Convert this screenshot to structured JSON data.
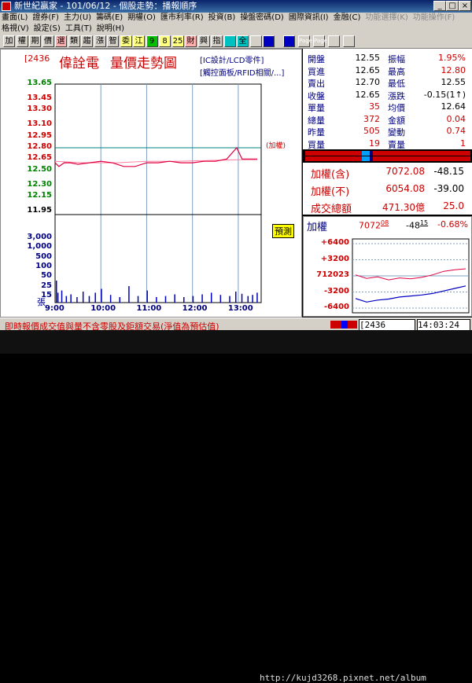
{
  "window": {
    "title": "新世紀贏家 - 101/06/12 - 個股走勢：播報順序"
  },
  "menu1": [
    "畫面(L)",
    "證券(F)",
    "主力(U)",
    "籌碼(E)",
    "期權(O)",
    "匯市利率(R)",
    "投資(B)",
    "操盤密碼(D)",
    "國際資訊(I)",
    "金融(C)",
    "功能選擇(K)",
    "功能操作(F)"
  ],
  "menu2": [
    "格視(V)",
    "設定(S)",
    "工具(T)",
    "說明(H)"
  ],
  "toolbar": [
    "加",
    "權",
    "期",
    "價",
    "選",
    "類",
    "趨",
    "漲",
    "智",
    "委",
    "江",
    "9",
    "8",
    "25",
    "財",
    "興",
    "指",
    "",
    "全",
    "",
    "",
    "",
    "Page",
    "Page",
    "",
    ""
  ],
  "stock": {
    "code": "[2436",
    "name": "偉詮電",
    "chart_title": "量價走勢圖",
    "industry1": "[IC設計/LCD零件]",
    "industry2": "[觸控面板/RFID相關/...]"
  },
  "lot_label": "(加權)",
  "vol_unit": "張",
  "estimate_tag": "預測",
  "chart_data": {
    "type": "line",
    "x_ticks": [
      "9:00",
      "10:00",
      "11:00",
      "12:00",
      "13:00"
    ],
    "price_ticks": [
      "13.65",
      "13.45",
      "13.30",
      "13.10",
      "12.95",
      "12.80",
      "12.65",
      "12.50",
      "12.30",
      "12.15",
      "11.95"
    ],
    "price_tick_colors": [
      "#008000",
      "#c00",
      "#c00",
      "#c00",
      "#c00",
      "#c00",
      "#c00",
      "#008000",
      "#008000",
      "#008000",
      "#000"
    ],
    "vol_ticks": [
      "3,000",
      "1,000",
      "500",
      "100",
      "50",
      "25",
      "15"
    ],
    "ref_price": 12.8,
    "ylim": [
      11.95,
      13.65
    ],
    "price_series": [
      {
        "t": 0,
        "v": 12.6
      },
      {
        "t": 5,
        "v": 12.55
      },
      {
        "t": 12,
        "v": 12.6
      },
      {
        "t": 20,
        "v": 12.6
      },
      {
        "t": 30,
        "v": 12.58
      },
      {
        "t": 45,
        "v": 12.6
      },
      {
        "t": 60,
        "v": 12.62
      },
      {
        "t": 75,
        "v": 12.6
      },
      {
        "t": 90,
        "v": 12.55
      },
      {
        "t": 105,
        "v": 12.55
      },
      {
        "t": 120,
        "v": 12.6
      },
      {
        "t": 135,
        "v": 12.6
      },
      {
        "t": 150,
        "v": 12.62
      },
      {
        "t": 165,
        "v": 12.6
      },
      {
        "t": 180,
        "v": 12.6
      },
      {
        "t": 195,
        "v": 12.62
      },
      {
        "t": 210,
        "v": 12.62
      },
      {
        "t": 225,
        "v": 12.65
      },
      {
        "t": 238,
        "v": 12.8
      },
      {
        "t": 245,
        "v": 12.65
      },
      {
        "t": 265,
        "v": 12.65
      }
    ],
    "avg_series": [
      {
        "t": 0,
        "v": 12.62
      },
      {
        "t": 40,
        "v": 12.6
      },
      {
        "t": 80,
        "v": 12.6
      },
      {
        "t": 120,
        "v": 12.62
      },
      {
        "t": 160,
        "v": 12.62
      },
      {
        "t": 200,
        "v": 12.63
      },
      {
        "t": 240,
        "v": 12.64
      },
      {
        "t": 265,
        "v": 12.64
      }
    ],
    "volume": [
      {
        "t": 1,
        "v": 40
      },
      {
        "t": 3,
        "v": 18
      },
      {
        "t": 8,
        "v": 22
      },
      {
        "t": 14,
        "v": 12
      },
      {
        "t": 20,
        "v": 15
      },
      {
        "t": 28,
        "v": 10
      },
      {
        "t": 36,
        "v": 20
      },
      {
        "t": 44,
        "v": 12
      },
      {
        "t": 52,
        "v": 18
      },
      {
        "t": 60,
        "v": 25
      },
      {
        "t": 72,
        "v": 14
      },
      {
        "t": 84,
        "v": 10
      },
      {
        "t": 96,
        "v": 30
      },
      {
        "t": 108,
        "v": 12
      },
      {
        "t": 120,
        "v": 22
      },
      {
        "t": 132,
        "v": 10
      },
      {
        "t": 144,
        "v": 12
      },
      {
        "t": 156,
        "v": 15
      },
      {
        "t": 168,
        "v": 10
      },
      {
        "t": 180,
        "v": 12
      },
      {
        "t": 192,
        "v": 15
      },
      {
        "t": 204,
        "v": 18
      },
      {
        "t": 216,
        "v": 14
      },
      {
        "t": 228,
        "v": 12
      },
      {
        "t": 236,
        "v": 20
      },
      {
        "t": 244,
        "v": 16
      },
      {
        "t": 252,
        "v": 12
      },
      {
        "t": 258,
        "v": 14
      },
      {
        "t": 264,
        "v": 18
      }
    ]
  },
  "quote": [
    {
      "l1": "開盤",
      "v1": "12.55",
      "c1": "#000",
      "l2": "振幅",
      "v2": "1.95%",
      "c2": "#c00"
    },
    {
      "l1": "買進",
      "v1": "12.65",
      "c1": "#000",
      "l2": "最高",
      "v2": "12.80",
      "c2": "#c00"
    },
    {
      "l1": "賣出",
      "v1": "12.70",
      "c1": "#000",
      "l2": "最低",
      "v2": "12.55",
      "c2": "#000"
    },
    {
      "l1": "收盤",
      "v1": "12.65",
      "c1": "#000",
      "l2": "漲跌",
      "v2": "-0.15(1↑)",
      "c2": "#000"
    },
    {
      "l1": "單量",
      "v1": "35",
      "c1": "#c00",
      "l2": "均價",
      "v2": "12.64",
      "c2": "#000"
    },
    {
      "l1": "總量",
      "v1": "372",
      "c1": "#c00",
      "l2": "金額",
      "v2": "0.04",
      "c2": "#c00"
    },
    {
      "l1": "昨量",
      "v1": "505",
      "c1": "#c00",
      "l2": "變動",
      "v2": "0.74",
      "c2": "#c00"
    },
    {
      "l1": "買量",
      "v1": "19",
      "c1": "#c00",
      "l2": "賣量",
      "v2": "1",
      "c2": "#c00"
    }
  ],
  "index": [
    {
      "label": "加權(含)",
      "value": "7072.08",
      "change": "-48.15",
      "chg_color": "#000"
    },
    {
      "label": "加權(不)",
      "value": "6054.08",
      "change": "-39.00",
      "chg_color": "#000"
    },
    {
      "label": "成交總額",
      "value": "471.30億",
      "change": "25.0",
      "chg_color": "#c00"
    }
  ],
  "mini": {
    "label": "加權",
    "value": "7072",
    "value_dec": "08",
    "change": "-48",
    "change_dec": "15",
    "pct": "-0.68%",
    "ticks": [
      "+6400",
      "+3200",
      "712023",
      "-3200",
      "-6400"
    ],
    "chart_data": {
      "type": "line",
      "ylim": [
        -6400,
        6400
      ],
      "red": [
        {
          "t": 0,
          "v": 200
        },
        {
          "t": 20,
          "v": -500
        },
        {
          "t": 40,
          "v": -200
        },
        {
          "t": 60,
          "v": -800
        },
        {
          "t": 80,
          "v": -400
        },
        {
          "t": 100,
          "v": -600
        },
        {
          "t": 120,
          "v": -300
        },
        {
          "t": 140,
          "v": 200
        },
        {
          "t": 160,
          "v": 900
        },
        {
          "t": 180,
          "v": 1200
        },
        {
          "t": 200,
          "v": 1400
        }
      ],
      "blue": [
        {
          "t": 0,
          "v": -4500
        },
        {
          "t": 20,
          "v": -5200
        },
        {
          "t": 40,
          "v": -4800
        },
        {
          "t": 60,
          "v": -4600
        },
        {
          "t": 80,
          "v": -4200
        },
        {
          "t": 100,
          "v": -4000
        },
        {
          "t": 120,
          "v": -3800
        },
        {
          "t": 140,
          "v": -3500
        },
        {
          "t": 160,
          "v": -3000
        },
        {
          "t": 180,
          "v": -2500
        },
        {
          "t": 200,
          "v": -2000
        }
      ]
    }
  },
  "status": {
    "note": "即時報價成交值與量不含零股及鉅額交易(淨值為預估值)",
    "code": "[2436",
    "time": "14:03:24"
  },
  "watermark": "http://kujd3268.pixnet.net/album"
}
